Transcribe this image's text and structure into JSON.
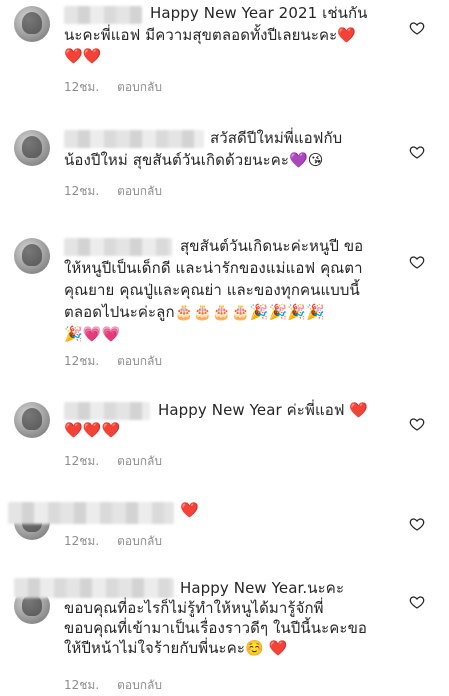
{
  "comments": [
    {
      "lines": [
        "Happy New Year 2021 เช่นกัน",
        "นะคะพี่แอฟ มีความสุขตลอดทั้งปีเลยนะคะ❤️",
        "❤️❤️"
      ],
      "time": "12ชม.",
      "reply": "ตอบกลับ"
    },
    {
      "lines": [
        "สวัสดีปีใหม่พี่แอฟกับ",
        "น้องปีใหม่ สุขสันต์วันเกิดด้วยนะคะ💜😘"
      ],
      "time": "12ชม.",
      "reply": "ตอบกลับ"
    },
    {
      "lines": [
        "สุขสันต์วันเกิดนะค่ะหนูปี ขอ",
        "ให้หนูปีเป็นเด็กดี และน่ารักของแม่แอฟ คุณตา",
        "คุณยาย คุณปู่และคุณย่า และของทุกคนแบบนี้",
        "ตลอดไปนะค่ะลูก🎂🎂🎂🎂🎉🎉🎉🎉",
        "🎉💗💗"
      ],
      "time": "12ชม.",
      "reply": "ตอบกลับ"
    },
    {
      "lines": [
        "Happy New Year ค่ะพี่แอฟ ❤️",
        "❤️❤️❤️"
      ],
      "time": "12ชม.",
      "reply": "ตอบกลับ"
    },
    {
      "lines": [
        "❤️"
      ],
      "time": "12ชม.",
      "reply": "ตอบกลับ"
    },
    {
      "lines": [
        "Happy New Year.นะคะ",
        "ขอบคุณที่อะไรก็ไม่รู้ทำให้หนูได้มารู้จักพี่",
        "ขอบคุณที่เข้ามาเป็นเรื่องราวดีๆ ในปีนี้นะคะขอ",
        "ให้ปีหน้าไม่ใจร้ายกับพี่นะคะ☺️ ❤️"
      ],
      "time": "12ชม.",
      "reply": "ตอบกลับ"
    }
  ],
  "colors": {
    "text": "#262626",
    "meta": "#8e8e8e",
    "icon": "#262626"
  },
  "icons": {
    "like": "heart-outline-icon"
  }
}
